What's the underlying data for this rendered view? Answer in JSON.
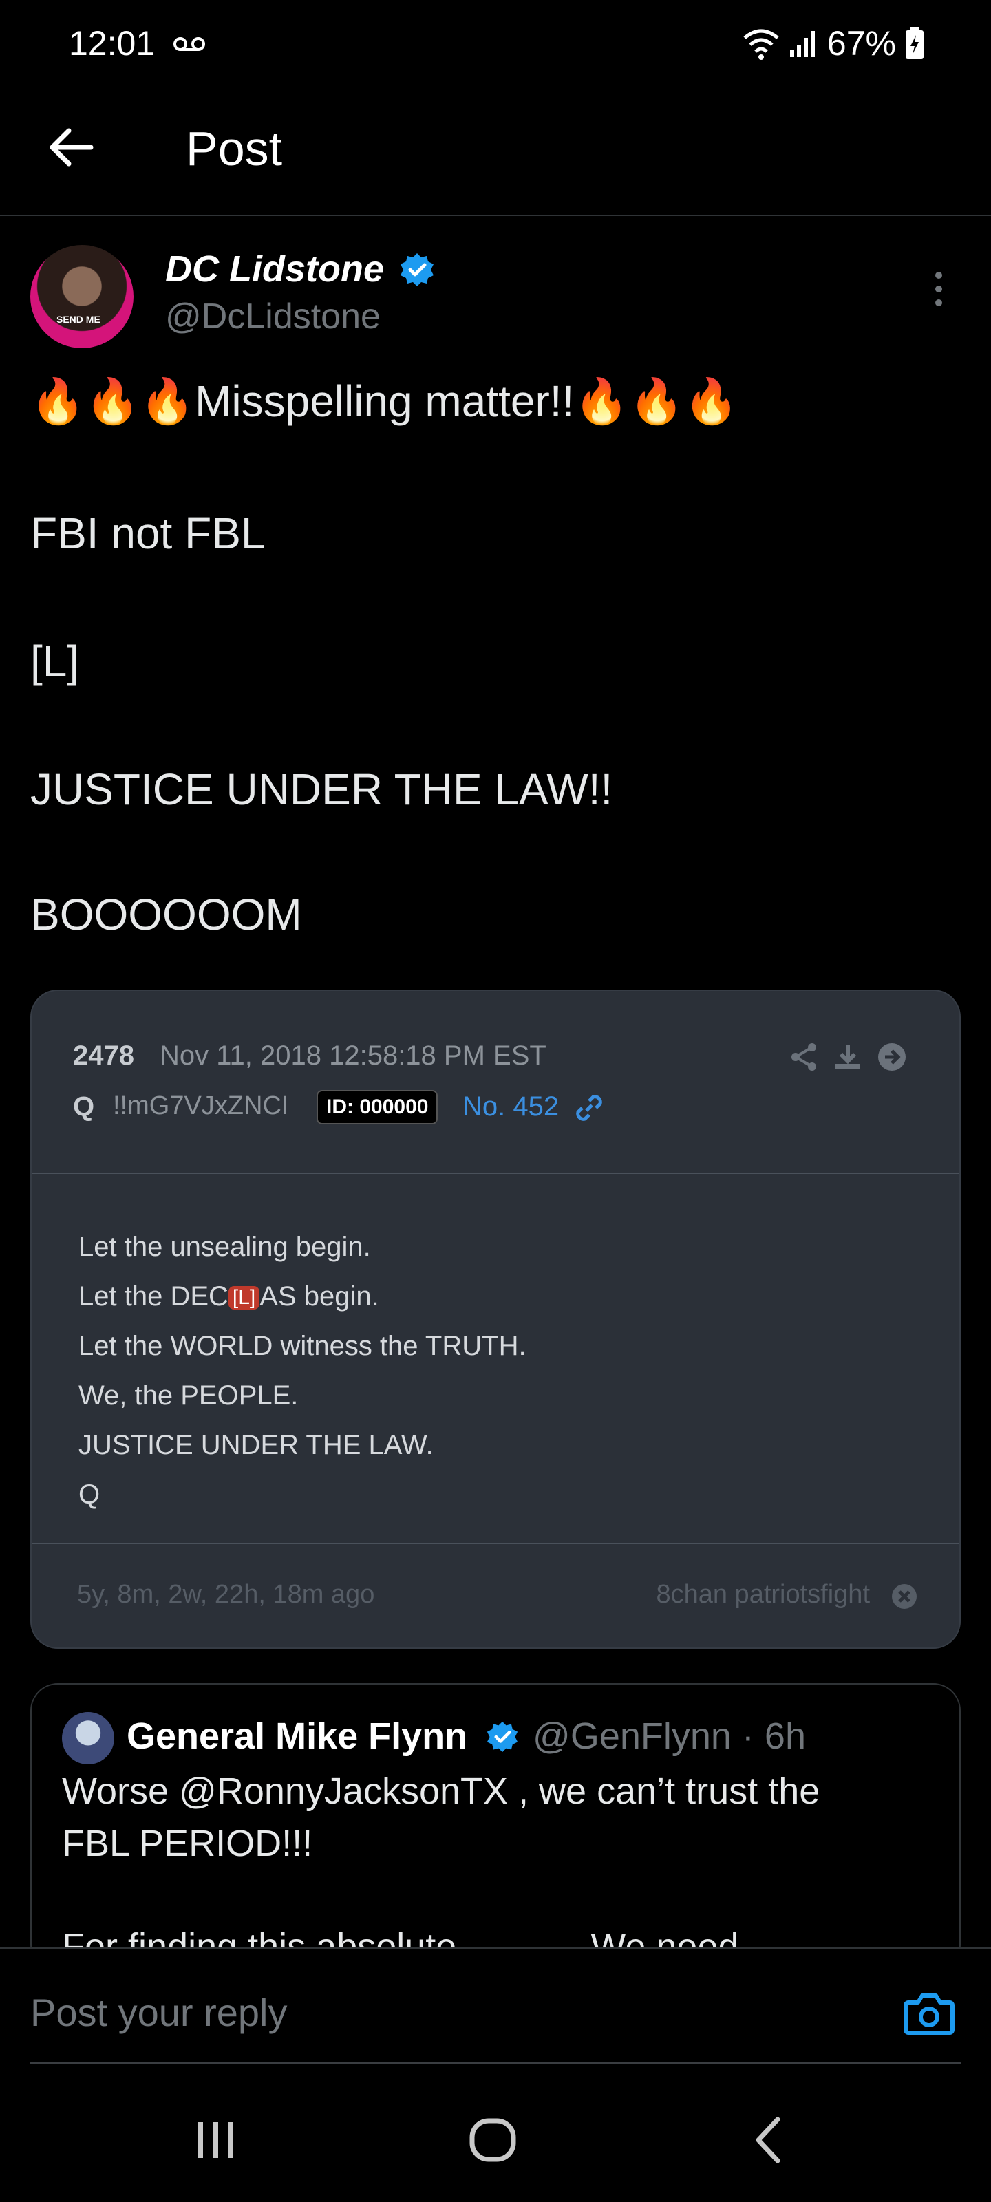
{
  "status_bar": {
    "time": "12:01",
    "battery": "67%"
  },
  "header": {
    "title": "Post"
  },
  "post": {
    "author_name": "DC Lidstone",
    "author_handle": "@DcLidstone",
    "avatar_badge": "SEND ME",
    "line1_fire_left": "🔥🔥🔥",
    "line1_text": "Misspelling matter!!",
    "line1_fire_right": "🔥🔥🔥",
    "line2": "FBI not FBL",
    "line3": "[L]",
    "line4": "JUSTICE UNDER THE LAW!!",
    "line5": "BOOOOOOM"
  },
  "q_card": {
    "number": "2478",
    "date": "Nov 11, 2018 12:58:18 PM EST",
    "name": "Q",
    "tripcode": "!!mG7VJxZNCI",
    "id_label": "ID: 000000",
    "post_no": "No. 452",
    "body": {
      "l1": "Let the unsealing begin.",
      "l2_a": "Let the DEC",
      "l2_badge": "[L]",
      "l2_b": "AS begin.",
      "l3": "Let the WORLD witness the TRUTH.",
      "l4": "We, the PEOPLE.",
      "l5": "JUSTICE UNDER THE LAW.",
      "l6": "Q"
    },
    "ago": "5y, 8m, 2w, 22h, 18m ago",
    "board": "8chan patriotsfight"
  },
  "quoted_tweet": {
    "name": "General Mike Flynn",
    "handle_time": "@GenFlynn · 6h",
    "line1": "Worse @RonnyJacksonTX , we can’t trust the",
    "line2": "FBL PERIOD!!!",
    "line3": "For finding this absolute ... ... ... We need"
  },
  "reply": {
    "placeholder": "Post your reply"
  },
  "colors": {
    "background": "#000000",
    "verified": "#1d9bf0",
    "link": "#3b8fe0",
    "card": "#2b3038"
  }
}
